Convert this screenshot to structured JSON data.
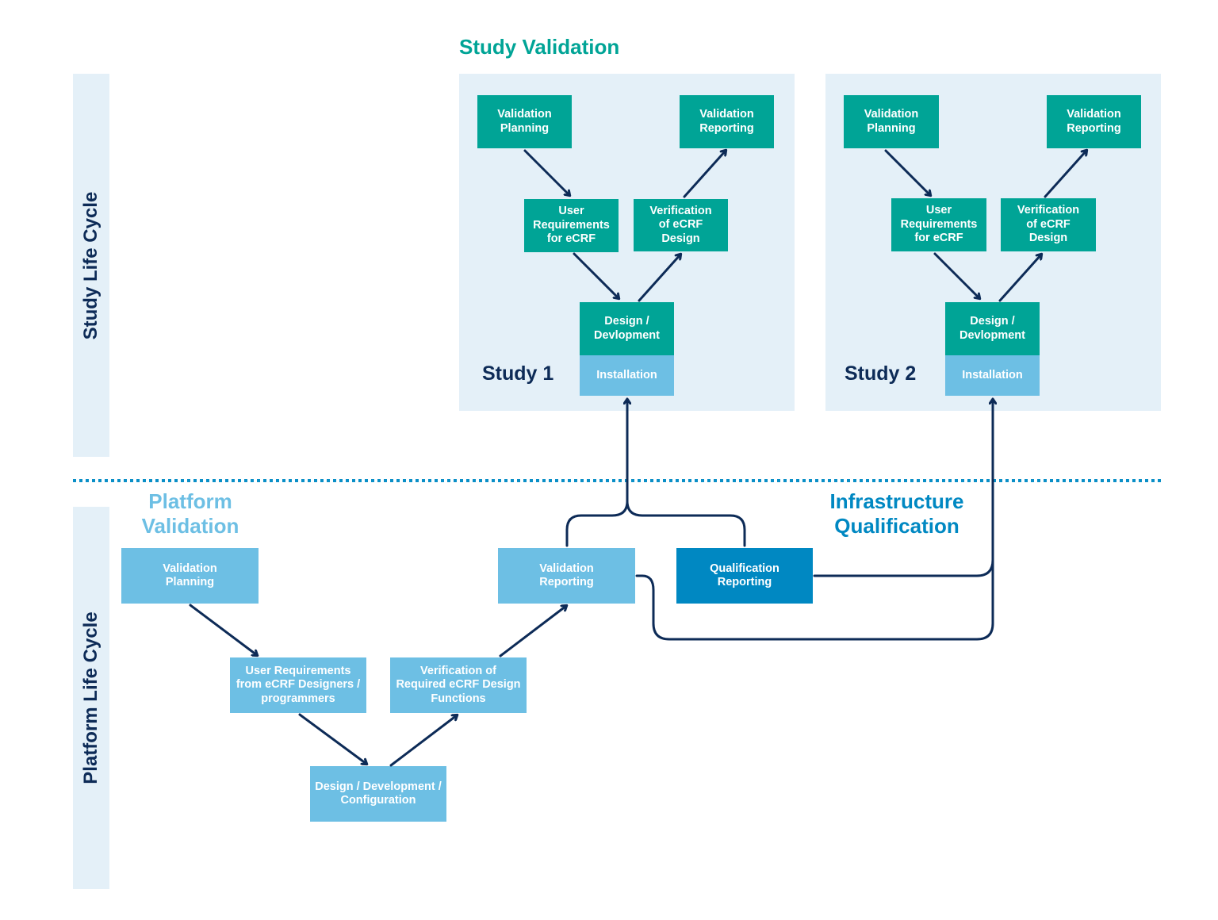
{
  "colors": {
    "teal": "#00a496",
    "light_blue": "#6dbfe4",
    "dark_blue": "#0088c2",
    "navy": "#0d2b57",
    "lane_bg": "#e4f0f8",
    "divider": "#0a8fc7"
  },
  "lanes": {
    "study": "Study Life Cycle",
    "platform": "Platform Life Cycle"
  },
  "titles": {
    "study_validation": "Study Validation",
    "platform_validation": "Platform\nValidation",
    "infrastructure_qualification": "Infrastructure\nQualification"
  },
  "studies": [
    {
      "label": "Study 1",
      "validation_planning": "Validation\nPlanning",
      "validation_reporting": "Validation\nReporting",
      "user_requirements": "User\nRequirements\nfor eCRF",
      "verification": "Verification\nof eCRF\nDesign",
      "design": "Design /\nDevlopment",
      "installation": "Installation"
    },
    {
      "label": "Study 2",
      "validation_planning": "Validation\nPlanning",
      "validation_reporting": "Validation\nReporting",
      "user_requirements": "User\nRequirements\nfor eCRF",
      "verification": "Verification\nof eCRF\nDesign",
      "design": "Design /\nDevlopment",
      "installation": "Installation"
    }
  ],
  "platform": {
    "validation_planning": "Validation\nPlanning",
    "user_requirements": "User Requirements\nfrom eCRF Designers /\nprogrammers",
    "design": "Design / Development /\nConfiguration",
    "verification": "Verification of\nRequired eCRF Design\nFunctions",
    "validation_reporting": "Validation\nReporting"
  },
  "infrastructure": {
    "qualification_reporting": "Qualification\nReporting"
  }
}
